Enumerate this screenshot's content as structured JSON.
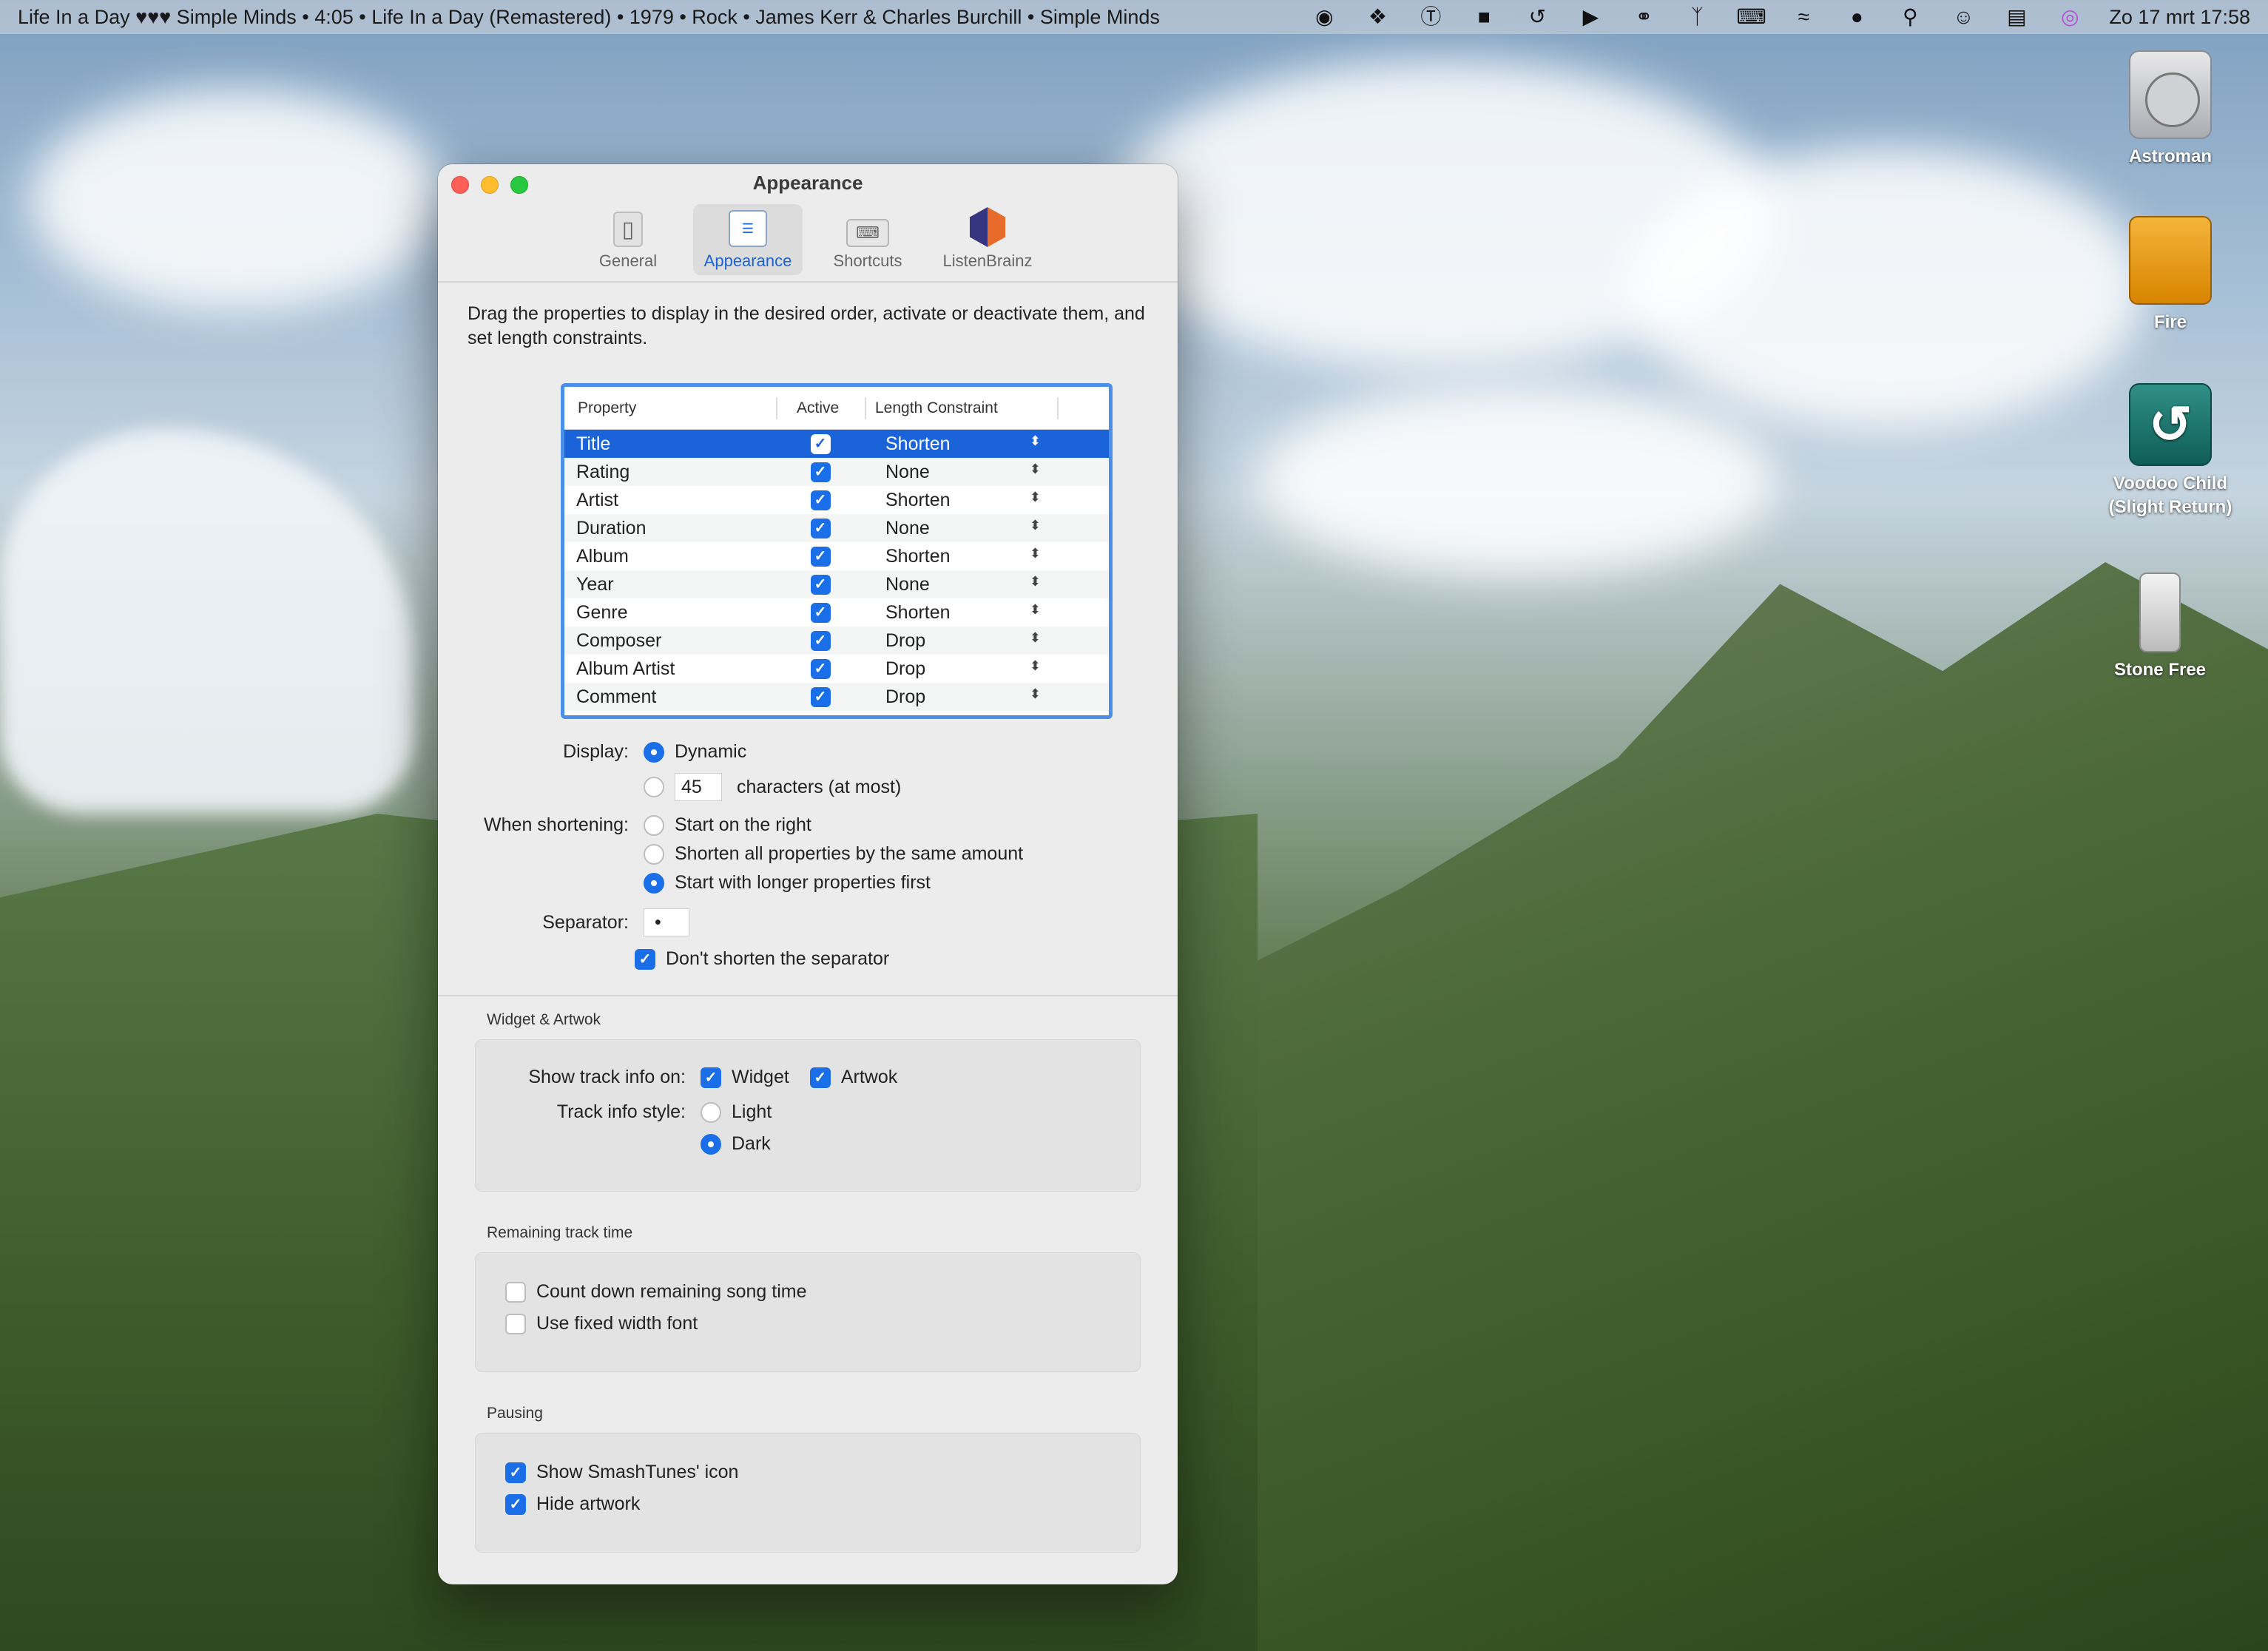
{
  "menubar": {
    "now_playing": "Life In a Day ♥♥♥ Simple Minds • 4:05 • Life In a Day (Remastered) • 1979 • Rock • James Kerr & Charles Burchill • Simple Minds",
    "clock": "Zo 17 mrt  17:58",
    "icons": [
      "creative-cloud-icon",
      "dropbox-icon",
      "onepassword-icon",
      "elephant-icon",
      "time-machine-icon",
      "play-icon",
      "headphones-icon",
      "bluetooth-icon",
      "keyboard-icon",
      "wifi-icon",
      "user-icon",
      "search-icon",
      "account-icon",
      "control-center-icon",
      "siri-icon"
    ]
  },
  "desktop": {
    "icons": [
      {
        "label": "Astroman"
      },
      {
        "label": "Fire"
      },
      {
        "label": "Voodoo Child (Slight Return)"
      },
      {
        "label": "Stone Free"
      }
    ]
  },
  "window": {
    "title": "Appearance",
    "tabs": [
      {
        "label": "General"
      },
      {
        "label": "Appearance"
      },
      {
        "label": "Shortcuts"
      },
      {
        "label": "ListenBrainz"
      }
    ],
    "intro": "Drag the properties to display in the desired order, activate or deactivate them, and set length constraints.",
    "table": {
      "headers": [
        "Property",
        "Active",
        "Length Constraint"
      ],
      "rows": [
        {
          "property": "Title",
          "active": true,
          "constraint": "Shorten"
        },
        {
          "property": "Rating",
          "active": true,
          "constraint": "None"
        },
        {
          "property": "Artist",
          "active": true,
          "constraint": "Shorten"
        },
        {
          "property": "Duration",
          "active": true,
          "constraint": "None"
        },
        {
          "property": "Album",
          "active": true,
          "constraint": "Shorten"
        },
        {
          "property": "Year",
          "active": true,
          "constraint": "None"
        },
        {
          "property": "Genre",
          "active": true,
          "constraint": "Shorten"
        },
        {
          "property": "Composer",
          "active": true,
          "constraint": "Drop"
        },
        {
          "property": "Album Artist",
          "active": true,
          "constraint": "Drop"
        },
        {
          "property": "Comment",
          "active": true,
          "constraint": "Drop"
        }
      ]
    },
    "display": {
      "label": "Display:",
      "dynamic": "Dynamic",
      "chars_value": "45",
      "chars_label": "characters (at most)"
    },
    "shortening": {
      "label": "When shortening:",
      "options": [
        "Start on the right",
        "Shorten all properties by the same amount",
        "Start with longer properties first"
      ]
    },
    "separator": {
      "label": "Separator:",
      "value": "•",
      "dont_shorten": "Don't shorten the separator"
    },
    "widget": {
      "title": "Widget & Artwok",
      "show_label": "Show track info on:",
      "widget": "Widget",
      "artwok": "Artwok",
      "style_label": "Track info style:",
      "light": "Light",
      "dark": "Dark"
    },
    "remaining": {
      "title": "Remaining track time",
      "countdown": "Count down remaining song time",
      "fixed_font": "Use fixed width font"
    },
    "pausing": {
      "title": "Pausing",
      "show_icon": "Show SmashTunes' icon",
      "hide_artwork": "Hide artwork"
    }
  }
}
